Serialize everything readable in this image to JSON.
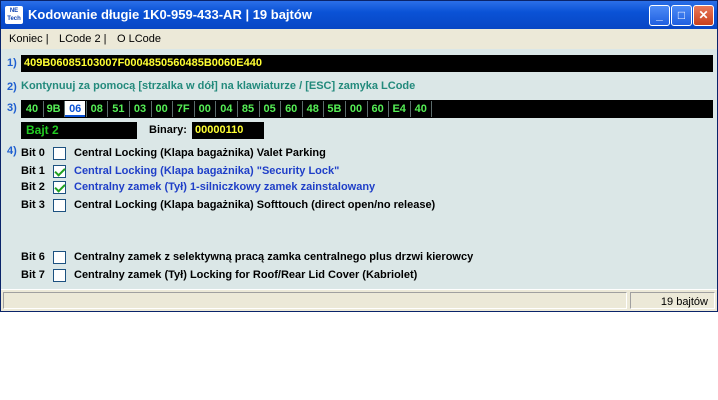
{
  "window": {
    "logo_text": "NE Tech",
    "title": "Kodowanie długie   1K0-959-433-AR  |  19 bajtów",
    "buttons": {
      "minimize": "_",
      "maximize": "□",
      "close": "✕"
    }
  },
  "menu": {
    "items": [
      "Koniec |",
      "LCode 2 |",
      "O LCode"
    ]
  },
  "row_labels": [
    "1)",
    "2)",
    "3)",
    "4)"
  ],
  "coding": {
    "code": "409B06085103007F0004850560485B0060E440"
  },
  "hint": "Kontynuuj za pomocą [strzalka w dół] na klawiaturze / [ESC] zamyka LCode",
  "bytes": {
    "values": [
      "40",
      "9B",
      "06",
      "08",
      "51",
      "03",
      "00",
      "7F",
      "00",
      "04",
      "85",
      "05",
      "60",
      "48",
      "5B",
      "00",
      "60",
      "E4",
      "40"
    ],
    "selected_index": 2
  },
  "byte_info": {
    "label": "Bajt 2",
    "binary_label": "Binary:",
    "binary_value": "00000110"
  },
  "bits": [
    {
      "label": "Bit 0",
      "checked": false,
      "desc": "Central Locking (Klapa bagażnika) Valet Parking"
    },
    {
      "label": "Bit 1",
      "checked": true,
      "desc": "Central Locking (Klapa bagażnika) \"Security Lock\""
    },
    {
      "label": "Bit 2",
      "checked": true,
      "desc": "Centralny zamek (Tył) 1-silniczkowy zamek zainstalowany"
    },
    {
      "label": "Bit 3",
      "checked": false,
      "desc": "Central Locking (Klapa bagażnika) Softtouch (direct open/no release)"
    },
    {
      "label": "Bit 6",
      "checked": false,
      "desc": "Centralny zamek z selektywną pracą zamka centralnego plus drzwi kierowcy"
    },
    {
      "label": "Bit 7",
      "checked": false,
      "desc": "Centralny zamek (Tył) Locking for Roof/Rear Lid Cover (Kabriolet)"
    }
  ],
  "status": {
    "text": "19 bajtów"
  },
  "colors": {
    "titlebar": "#0a52d6",
    "background": "#dbe7e7",
    "code_text": "#ffff33",
    "byte_text": "#55ee55",
    "hint_text": "#238a7c",
    "checked_desc": "#1f3fc8"
  }
}
